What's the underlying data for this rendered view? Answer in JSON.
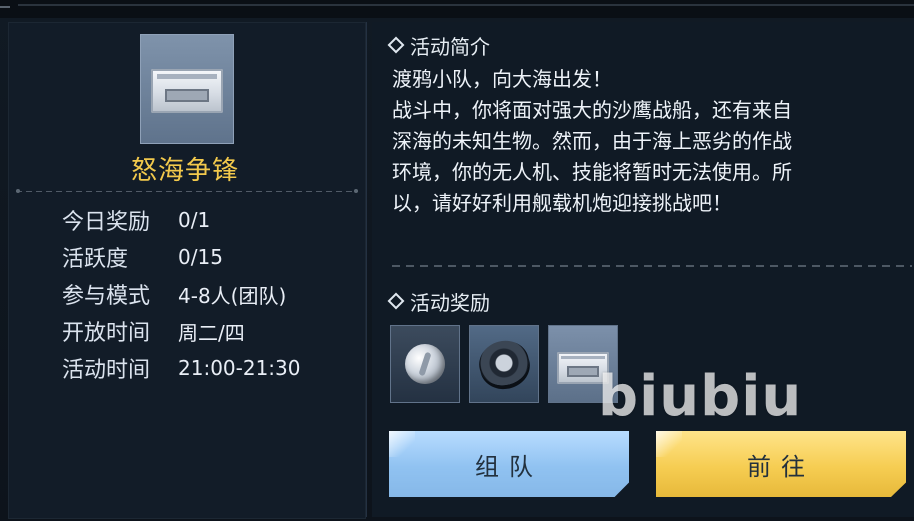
{
  "event": {
    "title": "怒海争锋",
    "icon": "supply-crate-icon"
  },
  "info": [
    {
      "label": "今日奖励",
      "value": "0/1"
    },
    {
      "label": "活跃度",
      "value": "0/15"
    },
    {
      "label": "参与模式",
      "value": "4-8人(团队)"
    },
    {
      "label": "开放时间",
      "value": "周二/四"
    },
    {
      "label": "活动时间",
      "value": "21:00-21:30"
    }
  ],
  "intro": {
    "heading": "活动简介",
    "line1": "渡鸦小队，向大海出发！",
    "line2": "战斗中，你将面对强大的沙鹰战船，还有来自",
    "line3": "深海的未知生物。然而，由于海上恶劣的作战",
    "line4": "环境，你的无人机、技能将暂时无法使用。所",
    "line5": "以，请好好利用舰载机炮迎接挑战吧！"
  },
  "rewards": {
    "heading": "活动奖励",
    "items": [
      {
        "icon": "coin-icon"
      },
      {
        "icon": "gear-disc-icon"
      },
      {
        "icon": "supply-crate-icon"
      }
    ]
  },
  "buttons": {
    "team": "组队",
    "go": "前往"
  },
  "watermark": "biubiu",
  "colors": {
    "title_gold": "#f2c94c",
    "team_button": "#9ccbf6",
    "go_button": "#f6cd52",
    "panel_bg": "#121c28"
  }
}
